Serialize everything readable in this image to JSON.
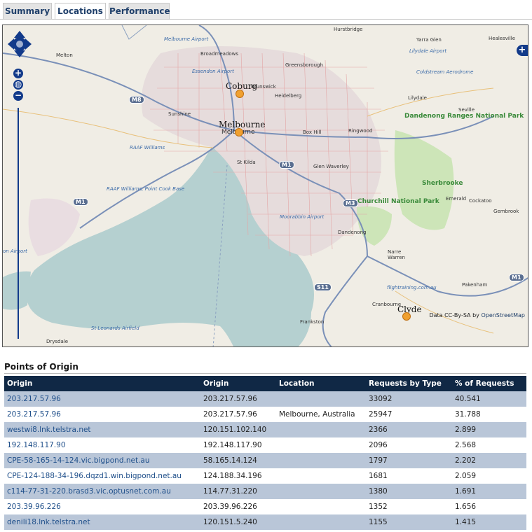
{
  "tabs": [
    {
      "label": "Summary"
    },
    {
      "label": "Locations"
    },
    {
      "label": "Performance"
    }
  ],
  "map": {
    "attribution_prefix": "Data CC-By-SA by",
    "attribution_link": "OpenStreetMap",
    "labels": {
      "hurstbridge": "Hurstbridge",
      "yarra_glen": "Yarra Glen",
      "healesville": "Healesville",
      "melbourne_airport": "Melbourne Airport",
      "melton": "Melton",
      "broadmeadows": "Broadmeadows",
      "lilydale_airport": "Lilydale Airport",
      "greensborough": "Greensborough",
      "essendon_airport": "Essendon Airport",
      "coldstream": "Coldstream Aerodrome",
      "coburg": "Coburg",
      "brunswick": "Brunswick",
      "heidelberg": "Heidelberg",
      "lilydale": "Lilydale",
      "seville": "Seville",
      "sunshine": "Sunshine",
      "melbourne_big": "Melbourne",
      "melbourne_small": "Melbourne",
      "box_hill": "Box Hill",
      "ringwood": "Ringwood",
      "raaf_williams": "RAAF Williams",
      "st_kilda": "St Kilda",
      "glen_waverley": "Glen Waverley",
      "raaf_point_cook": "RAAF Williams, Point Cook Base",
      "emerald": "Emerald",
      "cockatoo": "Cockatoo",
      "gembrook": "Gembrook",
      "moorabbin": "Moorabbin Airport",
      "dandenong": "Dandenong",
      "avalon": "on Airport",
      "narre_warren": "Narre Warren",
      "pakenham": "Pakenham",
      "flighttraining": "flightraining.com.au",
      "cranbourne": "Cranbourne",
      "clyde": "Clyde",
      "st_leonards": "St Leonards Airfield",
      "frankston": "Frankston",
      "drysdale": "Drysdale",
      "dandenong_ranges": "Dandenong Ranges National Park",
      "sherbrooke": "Sherbrooke",
      "churchill": "Churchill National Park"
    },
    "shields": [
      "M8",
      "M1",
      "M1",
      "M3",
      "S11",
      "M1"
    ]
  },
  "section": {
    "title": "Points of Origin"
  },
  "table": {
    "headers": [
      "Origin",
      "Origin",
      "Location",
      "Requests by Type",
      "% of Requests"
    ],
    "rows": [
      [
        "203.217.57.96",
        "203.217.57.96",
        "",
        "33092",
        "40.541"
      ],
      [
        "203.217.57.96",
        "203.217.57.96",
        "Melbourne, Australia",
        "25947",
        "31.788"
      ],
      [
        "westwi8.lnk.telstra.net",
        "120.151.102.140",
        "",
        "2366",
        "2.899"
      ],
      [
        "192.148.117.90",
        "192.148.117.90",
        "",
        "2096",
        "2.568"
      ],
      [
        "CPE-58-165-14-124.vic.bigpond.net.au",
        "58.165.14.124",
        "",
        "1797",
        "2.202"
      ],
      [
        "CPE-124-188-34-196.dqzd1.win.bigpond.net.au",
        "124.188.34.196",
        "",
        "1681",
        "2.059"
      ],
      [
        "c114-77-31-220.brasd3.vic.optusnet.com.au",
        "114.77.31.220",
        "",
        "1380",
        "1.691"
      ],
      [
        "203.39.96.226",
        "203.39.96.226",
        "",
        "1352",
        "1.656"
      ],
      [
        "denili18.lnk.telstra.net",
        "120.151.5.240",
        "",
        "1155",
        "1.415"
      ]
    ]
  },
  "colors": {
    "header_bg": "#102845",
    "stripe": "#b9c6d8",
    "link": "#1f4f8a",
    "pin": "#f0a030"
  }
}
